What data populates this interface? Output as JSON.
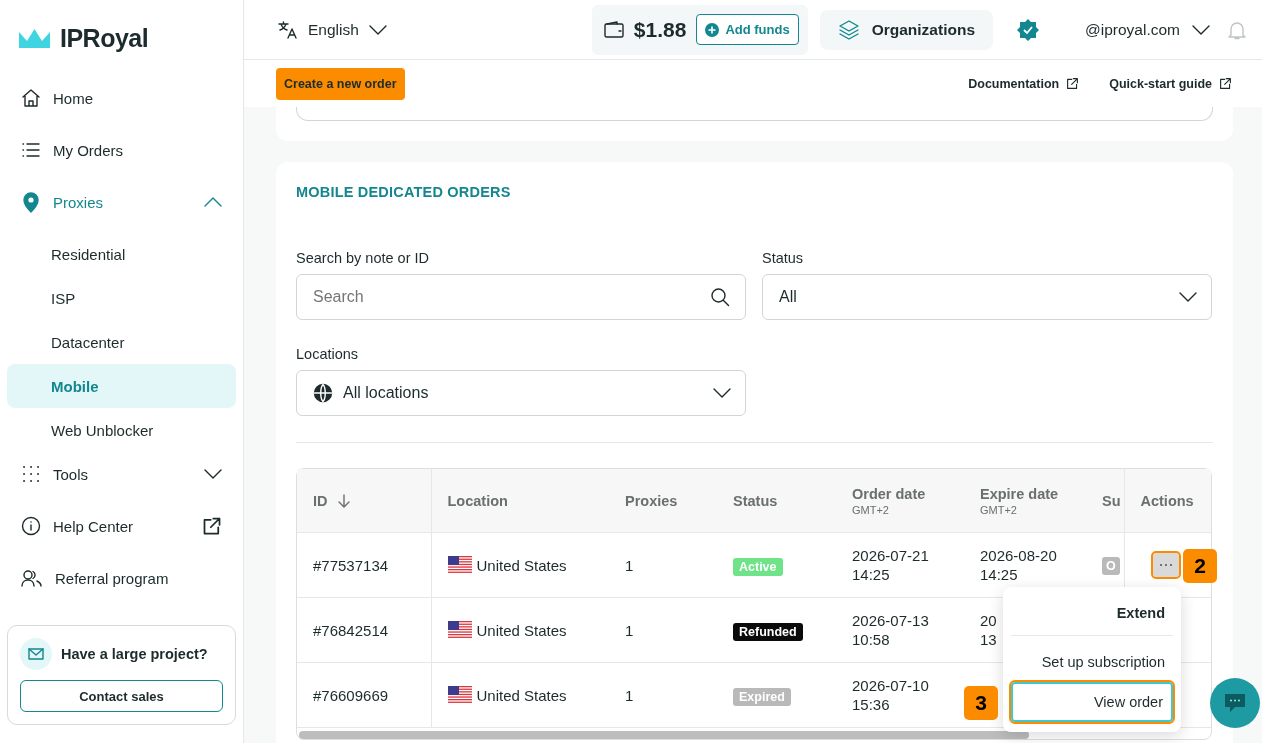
{
  "brand": {
    "name": "IPRoyal"
  },
  "sidebar": {
    "items": [
      {
        "label": "Home",
        "selected": false
      },
      {
        "label": "My Orders",
        "selected": false
      },
      {
        "label": "Proxies",
        "selected": false,
        "active_section": true,
        "expanded": true,
        "children": [
          {
            "label": "Residential",
            "selected": false
          },
          {
            "label": "ISP",
            "selected": false
          },
          {
            "label": "Datacenter",
            "selected": false
          },
          {
            "label": "Mobile",
            "selected": true
          },
          {
            "label": "Web Unblocker",
            "selected": false
          }
        ]
      },
      {
        "label": "Tools",
        "selected": false,
        "expanded": false
      },
      {
        "label": "Help Center",
        "selected": false,
        "external": true
      },
      {
        "label": "Referral program",
        "selected": false
      }
    ],
    "promo": {
      "title": "Have a large project?",
      "button": "Contact sales"
    }
  },
  "topbar": {
    "language": "English",
    "balance": "$1.88",
    "add_funds": "Add funds",
    "organizations": "Organizations",
    "verified": true,
    "account": "@iproyal.com"
  },
  "subbar": {
    "create_button": "Create a new order",
    "links": [
      "Documentation",
      "Quick-start guide"
    ]
  },
  "orders": {
    "title": "MOBILE DEDICATED ORDERS",
    "filters": {
      "search": {
        "label": "Search by note or ID",
        "placeholder": "Search"
      },
      "status": {
        "label": "Status",
        "value": "All"
      },
      "locations": {
        "label": "Locations",
        "value": "All locations"
      }
    },
    "table": {
      "columns": [
        {
          "label": "ID",
          "sorted_descending": true
        },
        {
          "label": "Location"
        },
        {
          "label": "Proxies"
        },
        {
          "label": "Status"
        },
        {
          "label": "Order date",
          "sub": "GMT+2"
        },
        {
          "label": "Expire date",
          "sub": "GMT+2"
        },
        {
          "label": "Su"
        },
        {
          "label": "Actions"
        }
      ],
      "rows": [
        {
          "id": "#77537134",
          "location": "United States",
          "proxies": "1",
          "status": {
            "label": "Active",
            "color": "#6fe387"
          },
          "order_date": "2026-07-21",
          "order_time": "14:25",
          "expire_date": "2026-08-20",
          "expire_time": "14:25",
          "subscription": "O",
          "menu_open": true
        },
        {
          "id": "#76842514",
          "location": "United States",
          "proxies": "1",
          "status": {
            "label": "Refunded",
            "color": "#0b0b0b"
          },
          "order_date": "2026-07-13",
          "order_time": "10:58",
          "expire_date": "20",
          "expire_time": "13",
          "menu_open": false
        },
        {
          "id": "#76609669",
          "location": "United States",
          "proxies": "1",
          "status": {
            "label": "Expired",
            "color": "#b9b9b9"
          },
          "order_date": "2026-07-10",
          "order_time": "15:36",
          "menu_open": false
        }
      ]
    },
    "action_menu": {
      "items": [
        {
          "label": "Extend",
          "kind": "primary",
          "focused": false
        },
        {
          "label": "Set up subscription",
          "kind": "item",
          "focused": false
        },
        {
          "label": "View order",
          "kind": "item",
          "focused": true
        }
      ]
    },
    "step_markers": [
      {
        "label": "2"
      },
      {
        "label": "3"
      }
    ]
  }
}
